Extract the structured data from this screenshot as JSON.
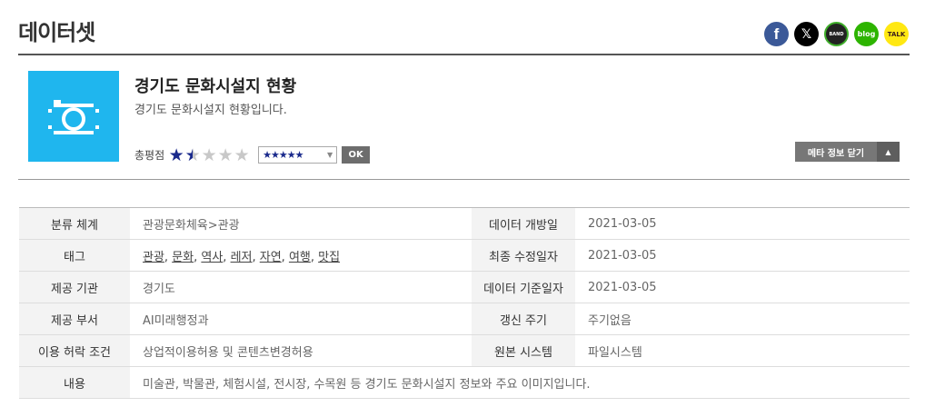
{
  "page": {
    "title": "데이터셋"
  },
  "share": {
    "facebook_glyph": "f",
    "x_glyph": "𝕏",
    "band_label": "BAND",
    "blog_label": "blog",
    "talk_label": "TALK"
  },
  "dataset": {
    "title": "경기도 문화시설지 현황",
    "description": "경기도 문화시설지 현황입니다.",
    "rating_label": "총평점",
    "rating_value": 1.5,
    "rating_max": 5,
    "rating_select_value": "★★★★★",
    "ok_label": "OK",
    "meta_toggle_label": "메타 정보 닫기",
    "meta_toggle_caret": "▲"
  },
  "colors": {
    "icon_bg": "#1fb6ee",
    "star_on": "#1a2a8c",
    "star_off": "#c8c8c8"
  },
  "meta": {
    "category_label": "분류 체계",
    "category_value": "관광문화체육>관광",
    "open_date_label": "데이터 개방일",
    "open_date_value": "2021-03-05",
    "tags_label": "태그",
    "tags": [
      "관광",
      "문화",
      "역사",
      "레저",
      "자연",
      "여행",
      "맛집"
    ],
    "modified_label": "최종 수정일자",
    "modified_value": "2021-03-05",
    "provider_label": "제공 기관",
    "provider_value": "경기도",
    "base_date_label": "데이터 기준일자",
    "base_date_value": "2021-03-05",
    "department_label": "제공 부서",
    "department_value": "AI미래행정과",
    "update_cycle_label": "갱신 주기",
    "update_cycle_value": "주기없음",
    "license_label": "이용 허락 조건",
    "license_value": "상업적이용허용 및 콘텐츠변경허용",
    "source_system_label": "원본 시스템",
    "source_system_value": "파일시스템",
    "content_label": "내용",
    "content_value": "미술관, 박물관, 체험시설, 전시장, 수목원 등 경기도 문화시설지 정보와 주요 이미지입니다."
  }
}
